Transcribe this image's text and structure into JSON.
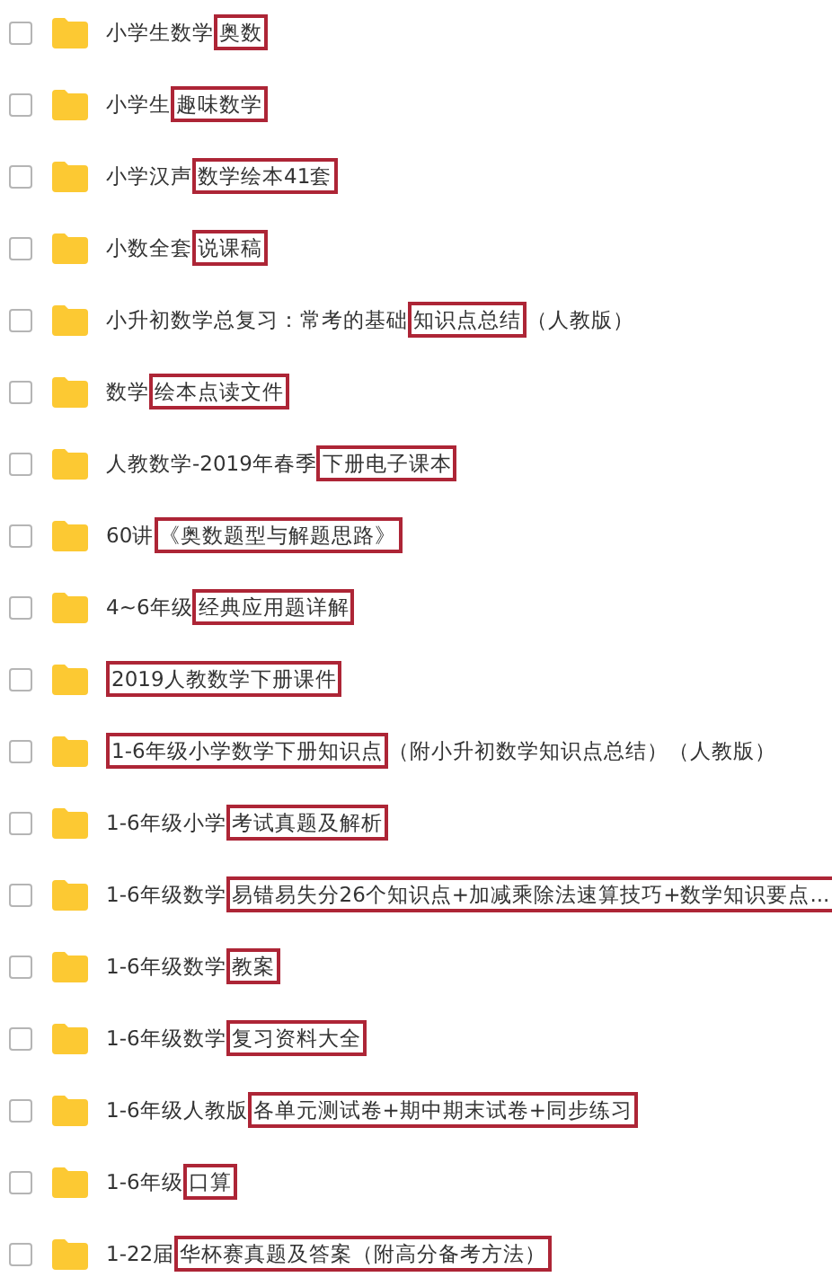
{
  "folders": [
    {
      "checked": false,
      "prefix": "小学生数学",
      "highlight": "奥数"
    },
    {
      "checked": false,
      "prefix": "小学生",
      "highlight": "趣味数学"
    },
    {
      "checked": false,
      "prefix": "小学汉声",
      "highlight": "数学绘本41套"
    },
    {
      "checked": false,
      "prefix": "小数全套",
      "highlight": "说课稿"
    },
    {
      "checked": false,
      "prefix": "小升初数学总复习：常考的基础",
      "highlight": "知识点总结",
      "suffix": "（人教版）"
    },
    {
      "checked": false,
      "prefix": "数学",
      "highlight": "绘本点读文件"
    },
    {
      "checked": false,
      "prefix": "人教数学-2019年春季",
      "highlight": "下册电子课本"
    },
    {
      "checked": false,
      "prefix": "60讲",
      "highlight": "《奥数题型与解题思路》"
    },
    {
      "checked": false,
      "prefix": "4~6年级",
      "highlight": "经典应用题详解"
    },
    {
      "checked": false,
      "highlight": "2019人教数学下册课件"
    },
    {
      "checked": false,
      "highlight": "1-6年级小学数学下册知识点",
      "suffix": "（附小升初数学知识点总结）（人教版）"
    },
    {
      "checked": false,
      "prefix": "1-6年级小学",
      "highlight": "考试真题及解析"
    },
    {
      "checked": false,
      "prefix": "1-6年级数学",
      "highlight": "易错易失分26个知识点+加减乘除法速算技巧+数学知识要点..."
    },
    {
      "checked": false,
      "prefix": "1-6年级数学",
      "highlight": "教案"
    },
    {
      "checked": false,
      "prefix": "1-6年级数学",
      "highlight": "复习资料大全"
    },
    {
      "checked": false,
      "prefix": "1-6年级人教版",
      "highlight": "各单元测试卷+期中期末试卷+同步练习"
    },
    {
      "checked": false,
      "prefix": "1-6年级",
      "highlight": "口算"
    },
    {
      "checked": false,
      "prefix": "1-22届",
      "highlight": "华杯赛真题及答案（附高分备考方法）"
    }
  ]
}
